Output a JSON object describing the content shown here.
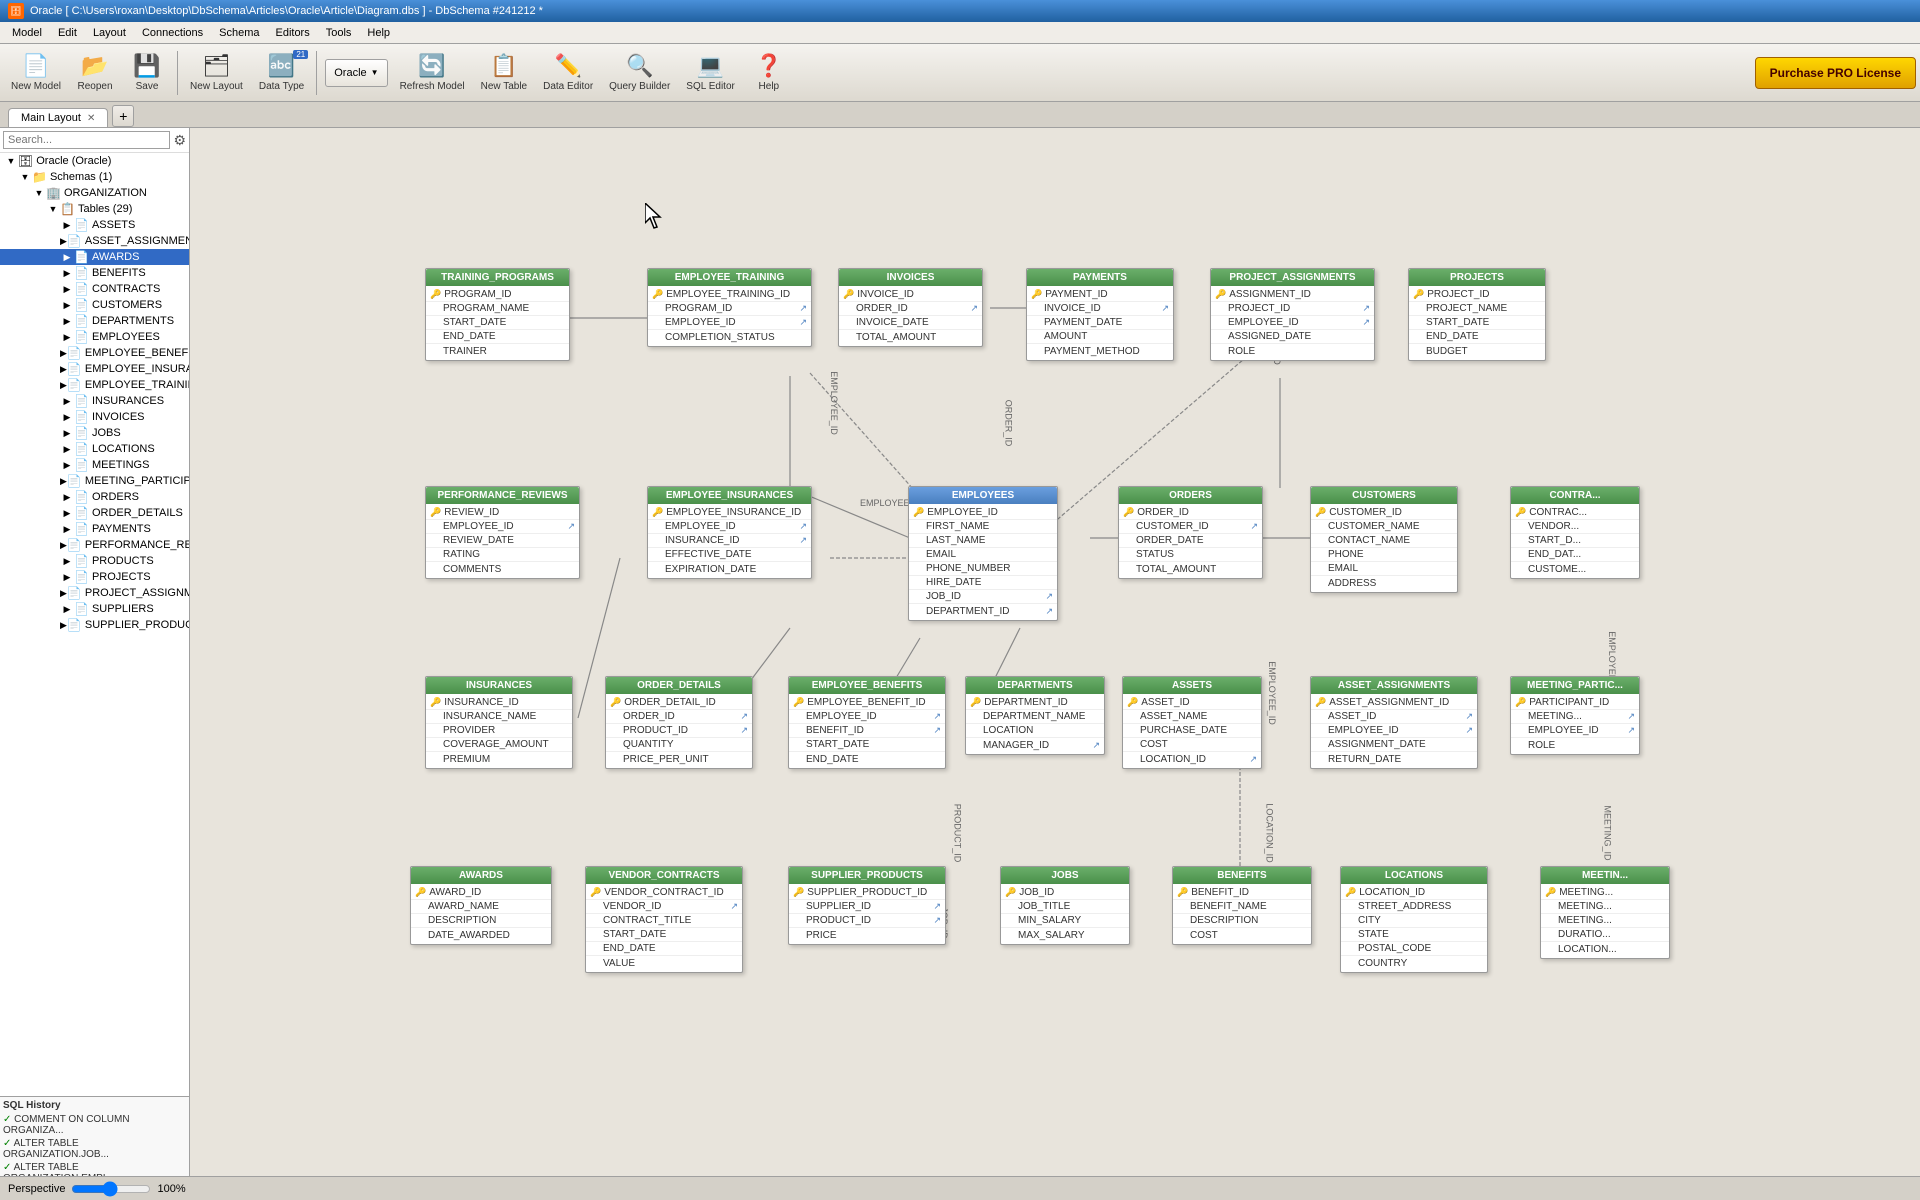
{
  "window": {
    "title": "Oracle [ C:\\Users\\roxan\\Desktop\\DbSchema\\Articles\\Oracle\\Article\\Diagram.dbs ] - DbSchema #241212 *"
  },
  "menu": {
    "items": [
      "Model",
      "Edit",
      "Layout",
      "Connections",
      "Schema",
      "Editors",
      "Tools",
      "Help"
    ]
  },
  "toolbar": {
    "new_model": "New Model",
    "reopen": "Reopen",
    "save": "Save",
    "new_layout": "New Layout",
    "data_type": "Data Type",
    "badge_count": "21",
    "oracle_label": "Oracle",
    "refresh_model": "Refresh Model",
    "new_table": "New Table",
    "data_editor": "Data Editor",
    "query_builder": "Query Builder",
    "sql_editor": "SQL Editor",
    "help": "Help",
    "purchase_pro": "Purchase PRO License"
  },
  "tabs": {
    "main_layout": "Main Layout",
    "add_tab": "+"
  },
  "sidebar": {
    "search_placeholder": "Search...",
    "tree": [
      {
        "label": "Oracle (Oracle)",
        "level": 1,
        "type": "db",
        "expanded": true
      },
      {
        "label": "Schemas (1)",
        "level": 2,
        "type": "schema",
        "expanded": true
      },
      {
        "label": "ORGANIZATION",
        "level": 3,
        "type": "org",
        "expanded": true
      },
      {
        "label": "Tables (29)",
        "level": 4,
        "type": "folder",
        "expanded": true
      },
      {
        "label": "ASSETS",
        "level": 5,
        "type": "table"
      },
      {
        "label": "ASSET_ASSIGNMENTS",
        "level": 5,
        "type": "table"
      },
      {
        "label": "AWARDS",
        "level": 5,
        "type": "table",
        "selected": true
      },
      {
        "label": "BENEFITS",
        "level": 5,
        "type": "table"
      },
      {
        "label": "CONTRACTS",
        "level": 5,
        "type": "table"
      },
      {
        "label": "CUSTOMERS",
        "level": 5,
        "type": "table"
      },
      {
        "label": "DEPARTMENTS",
        "level": 5,
        "type": "table"
      },
      {
        "label": "EMPLOYEES",
        "level": 5,
        "type": "table"
      },
      {
        "label": "EMPLOYEE_BENEFITS",
        "level": 5,
        "type": "table"
      },
      {
        "label": "EMPLOYEE_INSURANCES",
        "level": 5,
        "type": "table"
      },
      {
        "label": "EMPLOYEE_TRAINING",
        "level": 5,
        "type": "table"
      },
      {
        "label": "INSURANCES",
        "level": 5,
        "type": "table"
      },
      {
        "label": "INVOICES",
        "level": 5,
        "type": "table"
      },
      {
        "label": "JOBS",
        "level": 5,
        "type": "table"
      },
      {
        "label": "LOCATIONS",
        "level": 5,
        "type": "table"
      },
      {
        "label": "MEETINGS",
        "level": 5,
        "type": "table"
      },
      {
        "label": "MEETING_PARTICIPANTS",
        "level": 5,
        "type": "table"
      },
      {
        "label": "ORDERS",
        "level": 5,
        "type": "table"
      },
      {
        "label": "ORDER_DETAILS",
        "level": 5,
        "type": "table"
      },
      {
        "label": "PAYMENTS",
        "level": 5,
        "type": "table"
      },
      {
        "label": "PERFORMANCE_REVIEWS",
        "level": 5,
        "type": "table"
      },
      {
        "label": "PRODUCTS",
        "level": 5,
        "type": "table"
      },
      {
        "label": "PROJECTS",
        "level": 5,
        "type": "table"
      },
      {
        "label": "PROJECT_ASSIGNMENTS",
        "level": 5,
        "type": "table"
      },
      {
        "label": "SUPPLIERS",
        "level": 5,
        "type": "table"
      },
      {
        "label": "SUPPLIER_PRODUCTS",
        "level": 5,
        "type": "table"
      }
    ]
  },
  "sql_history": {
    "title": "SQL History",
    "entries": [
      "COMMENT ON COLUMN ORGANIZA...",
      "ALTER TABLE ORGANIZATION.JOB...",
      "ALTER TABLE ORGANIZATION.EMPL..."
    ]
  },
  "tables": {
    "training_programs": {
      "name": "TRAINING_PROGRAMS",
      "color": "green",
      "fields": [
        {
          "key": true,
          "name": "PROGRAM_ID",
          "fk": false
        },
        {
          "key": false,
          "name": "PROGRAM_NAME",
          "fk": false
        },
        {
          "key": false,
          "name": "START_DATE",
          "fk": false
        },
        {
          "key": false,
          "name": "END_DATE",
          "fk": false
        },
        {
          "key": false,
          "name": "TRAINER",
          "fk": false
        }
      ]
    },
    "employee_training": {
      "name": "EMPLOYEE_TRAINING",
      "color": "green",
      "fields": [
        {
          "key": true,
          "name": "EMPLOYEE_TRAINING_ID",
          "fk": false
        },
        {
          "key": false,
          "name": "PROGRAM_ID",
          "fk": true
        },
        {
          "key": false,
          "name": "EMPLOYEE_ID",
          "fk": true
        },
        {
          "key": false,
          "name": "COMPLETION_STATUS",
          "fk": false
        }
      ]
    },
    "invoices": {
      "name": "INVOICES",
      "color": "green",
      "fields": [
        {
          "key": true,
          "name": "INVOICE_ID",
          "fk": false
        },
        {
          "key": false,
          "name": "ORDER_ID",
          "fk": true
        },
        {
          "key": false,
          "name": "INVOICE_DATE",
          "fk": false
        },
        {
          "key": false,
          "name": "TOTAL_AMOUNT",
          "fk": false
        }
      ]
    },
    "payments": {
      "name": "PAYMENTS",
      "color": "green",
      "fields": [
        {
          "key": true,
          "name": "PAYMENT_ID",
          "fk": false
        },
        {
          "key": false,
          "name": "INVOICE_ID",
          "fk": true
        },
        {
          "key": false,
          "name": "PAYMENT_DATE",
          "fk": false
        },
        {
          "key": false,
          "name": "AMOUNT",
          "fk": false
        },
        {
          "key": false,
          "name": "PAYMENT_METHOD",
          "fk": false
        }
      ]
    },
    "project_assignments": {
      "name": "PROJECT_ASSIGNMENTS",
      "color": "green",
      "fields": [
        {
          "key": true,
          "name": "ASSIGNMENT_ID",
          "fk": false
        },
        {
          "key": false,
          "name": "PROJECT_ID",
          "fk": true
        },
        {
          "key": false,
          "name": "EMPLOYEE_ID",
          "fk": true
        },
        {
          "key": false,
          "name": "ASSIGNED_DATE",
          "fk": false
        },
        {
          "key": false,
          "name": "ROLE",
          "fk": false
        }
      ]
    },
    "projects": {
      "name": "PROJECTS",
      "color": "green",
      "fields": [
        {
          "key": true,
          "name": "PROJECT_ID",
          "fk": false
        },
        {
          "key": false,
          "name": "PROJECT_NAME",
          "fk": false
        },
        {
          "key": false,
          "name": "START_DATE",
          "fk": false
        },
        {
          "key": false,
          "name": "END_DATE",
          "fk": false
        },
        {
          "key": false,
          "name": "BUDGET",
          "fk": false
        }
      ]
    },
    "performance_reviews": {
      "name": "PERFORMANCE_REVIEWS",
      "color": "green",
      "fields": [
        {
          "key": true,
          "name": "REVIEW_ID",
          "fk": false
        },
        {
          "key": false,
          "name": "EMPLOYEE_ID",
          "fk": true
        },
        {
          "key": false,
          "name": "REVIEW_DATE",
          "fk": false
        },
        {
          "key": false,
          "name": "RATING",
          "fk": false
        },
        {
          "key": false,
          "name": "COMMENTS",
          "fk": false
        }
      ]
    },
    "employee_insurances": {
      "name": "EMPLOYEE_INSURANCES",
      "color": "green",
      "fields": [
        {
          "key": true,
          "name": "EMPLOYEE_INSURANCE_ID",
          "fk": false
        },
        {
          "key": false,
          "name": "EMPLOYEE_ID",
          "fk": true
        },
        {
          "key": false,
          "name": "INSURANCE_ID",
          "fk": true
        },
        {
          "key": false,
          "name": "EFFECTIVE_DATE",
          "fk": false
        },
        {
          "key": false,
          "name": "EXPIRATION_DATE",
          "fk": false
        }
      ]
    },
    "employees": {
      "name": "EMPLOYEES",
      "color": "blue",
      "fields": [
        {
          "key": true,
          "name": "EMPLOYEE_ID",
          "fk": false
        },
        {
          "key": false,
          "name": "FIRST_NAME",
          "fk": false
        },
        {
          "key": false,
          "name": "LAST_NAME",
          "fk": false
        },
        {
          "key": false,
          "name": "EMAIL",
          "fk": false
        },
        {
          "key": false,
          "name": "PHONE_NUMBER",
          "fk": false
        },
        {
          "key": false,
          "name": "HIRE_DATE",
          "fk": false
        },
        {
          "key": false,
          "name": "JOB_ID",
          "fk": true
        },
        {
          "key": false,
          "name": "DEPARTMENT_ID",
          "fk": true
        }
      ]
    },
    "orders": {
      "name": "ORDERS",
      "color": "green",
      "fields": [
        {
          "key": true,
          "name": "ORDER_ID",
          "fk": false
        },
        {
          "key": false,
          "name": "CUSTOMER_ID",
          "fk": true
        },
        {
          "key": false,
          "name": "ORDER_DATE",
          "fk": false
        },
        {
          "key": false,
          "name": "STATUS",
          "fk": false
        },
        {
          "key": false,
          "name": "TOTAL_AMOUNT",
          "fk": false
        }
      ]
    },
    "customers": {
      "name": "CUSTOMERS",
      "color": "green",
      "fields": [
        {
          "key": true,
          "name": "CUSTOMER_ID",
          "fk": false
        },
        {
          "key": false,
          "name": "CUSTOMER_NAME",
          "fk": false
        },
        {
          "key": false,
          "name": "CONTACT_NAME",
          "fk": false
        },
        {
          "key": false,
          "name": "PHONE",
          "fk": false
        },
        {
          "key": false,
          "name": "EMAIL",
          "fk": false
        },
        {
          "key": false,
          "name": "ADDRESS",
          "fk": false
        }
      ]
    },
    "contracts": {
      "name": "CONTRA...",
      "color": "green",
      "fields": [
        {
          "key": true,
          "name": "CONTRAC...",
          "fk": false
        },
        {
          "key": false,
          "name": "VENDOR...",
          "fk": false
        },
        {
          "key": false,
          "name": "START_D...",
          "fk": false
        },
        {
          "key": false,
          "name": "END_DAT...",
          "fk": false
        },
        {
          "key": false,
          "name": "CUSTOME...",
          "fk": false
        }
      ]
    },
    "insurances": {
      "name": "INSURANCES",
      "color": "green",
      "fields": [
        {
          "key": true,
          "name": "INSURANCE_ID",
          "fk": false
        },
        {
          "key": false,
          "name": "INSURANCE_NAME",
          "fk": false
        },
        {
          "key": false,
          "name": "PROVIDER",
          "fk": false
        },
        {
          "key": false,
          "name": "COVERAGE_AMOUNT",
          "fk": false
        },
        {
          "key": false,
          "name": "PREMIUM",
          "fk": false
        }
      ]
    },
    "order_details": {
      "name": "ORDER_DETAILS",
      "color": "green",
      "fields": [
        {
          "key": true,
          "name": "ORDER_DETAIL_ID",
          "fk": false
        },
        {
          "key": false,
          "name": "ORDER_ID",
          "fk": true
        },
        {
          "key": false,
          "name": "PRODUCT_ID",
          "fk": true
        },
        {
          "key": false,
          "name": "QUANTITY",
          "fk": false
        },
        {
          "key": false,
          "name": "PRICE_PER_UNIT",
          "fk": false
        }
      ]
    },
    "employee_benefits": {
      "name": "EMPLOYEE_BENEFITS",
      "color": "green",
      "fields": [
        {
          "key": true,
          "name": "EMPLOYEE_BENEFIT_ID",
          "fk": false
        },
        {
          "key": false,
          "name": "EMPLOYEE_ID",
          "fk": true
        },
        {
          "key": false,
          "name": "BENEFIT_ID",
          "fk": true
        },
        {
          "key": false,
          "name": "START_DATE",
          "fk": false
        },
        {
          "key": false,
          "name": "END_DATE",
          "fk": false
        }
      ]
    },
    "departments": {
      "name": "DEPARTMENTS",
      "color": "green",
      "fields": [
        {
          "key": true,
          "name": "DEPARTMENT_ID",
          "fk": false
        },
        {
          "key": false,
          "name": "DEPARTMENT_NAME",
          "fk": false
        },
        {
          "key": false,
          "name": "LOCATION",
          "fk": false
        },
        {
          "key": false,
          "name": "MANAGER_ID",
          "fk": true
        }
      ]
    },
    "assets": {
      "name": "ASSETS",
      "color": "green",
      "fields": [
        {
          "key": true,
          "name": "ASSET_ID",
          "fk": false
        },
        {
          "key": false,
          "name": "ASSET_NAME",
          "fk": false
        },
        {
          "key": false,
          "name": "PURCHASE_DATE",
          "fk": false
        },
        {
          "key": false,
          "name": "COST",
          "fk": false
        },
        {
          "key": false,
          "name": "LOCATION_ID",
          "fk": true
        }
      ]
    },
    "asset_assignments": {
      "name": "ASSET_ASSIGNMENTS",
      "color": "green",
      "fields": [
        {
          "key": true,
          "name": "ASSET_ASSIGNMENT_ID",
          "fk": false
        },
        {
          "key": false,
          "name": "ASSET_ID",
          "fk": true
        },
        {
          "key": false,
          "name": "EMPLOYEE_ID",
          "fk": true
        },
        {
          "key": false,
          "name": "ASSIGNMENT_DATE",
          "fk": false
        },
        {
          "key": false,
          "name": "RETURN_DATE",
          "fk": false
        }
      ]
    },
    "meeting_participants": {
      "name": "MEETING_PARTIC...",
      "color": "green",
      "fields": [
        {
          "key": true,
          "name": "PARTICIPANT_ID",
          "fk": false
        },
        {
          "key": false,
          "name": "MEETING...",
          "fk": true
        },
        {
          "key": false,
          "name": "EMPLOYEE_ID",
          "fk": true
        },
        {
          "key": false,
          "name": "ROLE",
          "fk": false
        }
      ]
    },
    "awards": {
      "name": "AWARDS",
      "color": "green",
      "fields": [
        {
          "key": true,
          "name": "AWARD_ID",
          "fk": false
        },
        {
          "key": false,
          "name": "AWARD_NAME",
          "fk": false
        },
        {
          "key": false,
          "name": "DESCRIPTION",
          "fk": false
        },
        {
          "key": false,
          "name": "DATE_AWARDED",
          "fk": false
        }
      ]
    },
    "vendor_contracts": {
      "name": "VENDOR_CONTRACTS",
      "color": "green",
      "fields": [
        {
          "key": true,
          "name": "VENDOR_CONTRACT_ID",
          "fk": false
        },
        {
          "key": false,
          "name": "VENDOR_ID",
          "fk": true
        },
        {
          "key": false,
          "name": "CONTRACT_TITLE",
          "fk": false
        },
        {
          "key": false,
          "name": "START_DATE",
          "fk": false
        },
        {
          "key": false,
          "name": "END_DATE",
          "fk": false
        },
        {
          "key": false,
          "name": "VALUE",
          "fk": false
        }
      ]
    },
    "supplier_products": {
      "name": "SUPPLIER_PRODUCTS",
      "color": "green",
      "fields": [
        {
          "key": true,
          "name": "SUPPLIER_PRODUCT_ID",
          "fk": false
        },
        {
          "key": false,
          "name": "SUPPLIER_ID",
          "fk": true
        },
        {
          "key": false,
          "name": "PRODUCT_ID",
          "fk": true
        },
        {
          "key": false,
          "name": "PRICE",
          "fk": false
        }
      ]
    },
    "jobs": {
      "name": "JOBS",
      "color": "green",
      "fields": [
        {
          "key": true,
          "name": "JOB_ID",
          "fk": false
        },
        {
          "key": false,
          "name": "JOB_TITLE",
          "fk": false
        },
        {
          "key": false,
          "name": "MIN_SALARY",
          "fk": false
        },
        {
          "key": false,
          "name": "MAX_SALARY",
          "fk": false
        }
      ]
    },
    "benefits": {
      "name": "BENEFITS",
      "color": "green",
      "fields": [
        {
          "key": true,
          "name": "BENEFIT_ID",
          "fk": false
        },
        {
          "key": false,
          "name": "BENEFIT_NAME",
          "fk": false
        },
        {
          "key": false,
          "name": "DESCRIPTION",
          "fk": false
        },
        {
          "key": false,
          "name": "COST",
          "fk": false
        }
      ]
    },
    "locations": {
      "name": "LOCATIONS",
      "color": "green",
      "fields": [
        {
          "key": true,
          "name": "LOCATION_ID",
          "fk": false
        },
        {
          "key": false,
          "name": "STREET_ADDRESS",
          "fk": false
        },
        {
          "key": false,
          "name": "CITY",
          "fk": false
        },
        {
          "key": false,
          "name": "STATE",
          "fk": false
        },
        {
          "key": false,
          "name": "POSTAL_CODE",
          "fk": false
        },
        {
          "key": false,
          "name": "COUNTRY",
          "fk": false
        }
      ]
    },
    "meetings_partial": {
      "name": "MEETIN...",
      "color": "green",
      "fields": [
        {
          "key": true,
          "name": "MEETING...",
          "fk": false
        },
        {
          "key": false,
          "name": "MEETING...",
          "fk": false
        },
        {
          "key": false,
          "name": "MEETING...",
          "fk": false
        },
        {
          "key": false,
          "name": "DURATIO...",
          "fk": false
        },
        {
          "key": false,
          "name": "LOCATION...",
          "fk": false
        }
      ]
    }
  },
  "perspective": {
    "label": "Perspective",
    "zoom": "100%"
  }
}
